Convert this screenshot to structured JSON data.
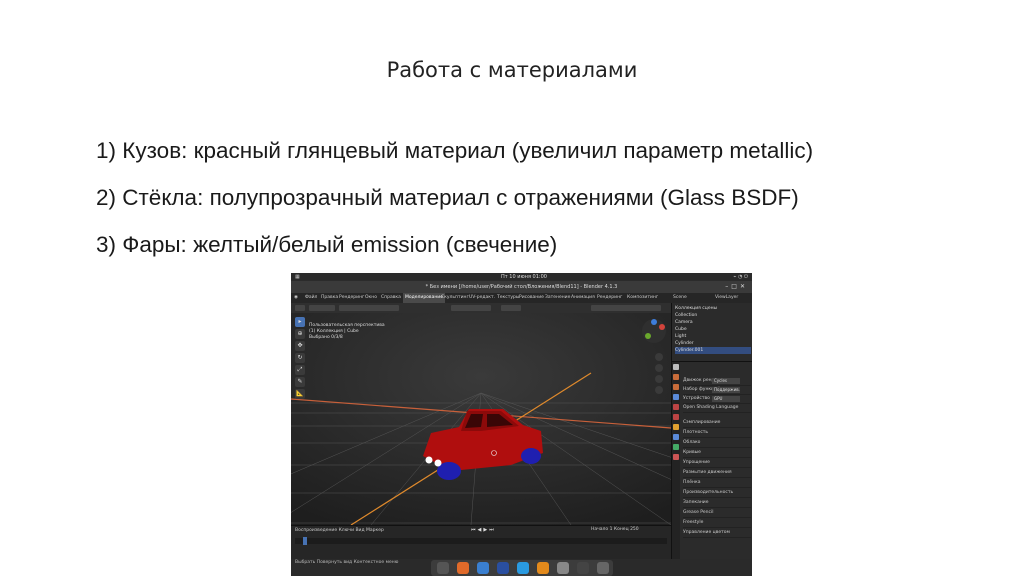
{
  "slide": {
    "title": "Работа с материалами",
    "bullets": [
      "1) Кузов: красный глянцевый материал (увеличил параметр metallic)",
      "2) Стёкла: полупрозрачный материал с отражениями (Glass BSDF)",
      "3) Фары: желтый/белый emission (свечение)"
    ]
  },
  "blender": {
    "clock": "Пт 10 июня 01:00",
    "window_title": "* Без имени [/home/user/Рабочий стол/Вложения/Blend11] - Blender 4.1.3",
    "menu": [
      "Файл",
      "Правка",
      "Рендеринг",
      "Окно",
      "Справка"
    ],
    "workspaces": [
      "Моделирование",
      "Скульптинг",
      "UV-редакт.",
      "Текстуры",
      "Рисование",
      "Затенение",
      "Анимация",
      "Рендеринг",
      "Композитинг"
    ],
    "active_workspace": "Моделирование",
    "scene_label": "Scene",
    "viewlayer_label": "ViewLayer",
    "viewport_info": [
      "Пользовательская перспектива",
      "(1) Коллекция | Cube",
      "Выбрано 0/3/8"
    ],
    "outliner": [
      "Коллекция сцены",
      "Collection",
      "Camera",
      "Cube",
      "Light",
      "Cylinder",
      "Cylinder.001"
    ],
    "props": [
      "Движок рендера",
      "Набор функций",
      "Устройство",
      "Open Shading Language",
      "Сэмплирование",
      "Плотность",
      "Облако",
      "Кривые",
      "Упрощение",
      "Размытие движения",
      "Плёнка",
      "Производительность",
      "Запекание",
      "Grease Pencil",
      "Freestyle",
      "Управление цветом"
    ],
    "props_values": [
      "Cycles",
      "Поддержив.",
      "GPU"
    ],
    "timeline_row": [
      "Воспроизведение",
      "Ключи",
      "Вид",
      "Маркер"
    ],
    "frame_fields": [
      "Начало 1",
      "Конец 250"
    ],
    "status": "Выбрать    Повернуть вид    Контекстное меню"
  }
}
